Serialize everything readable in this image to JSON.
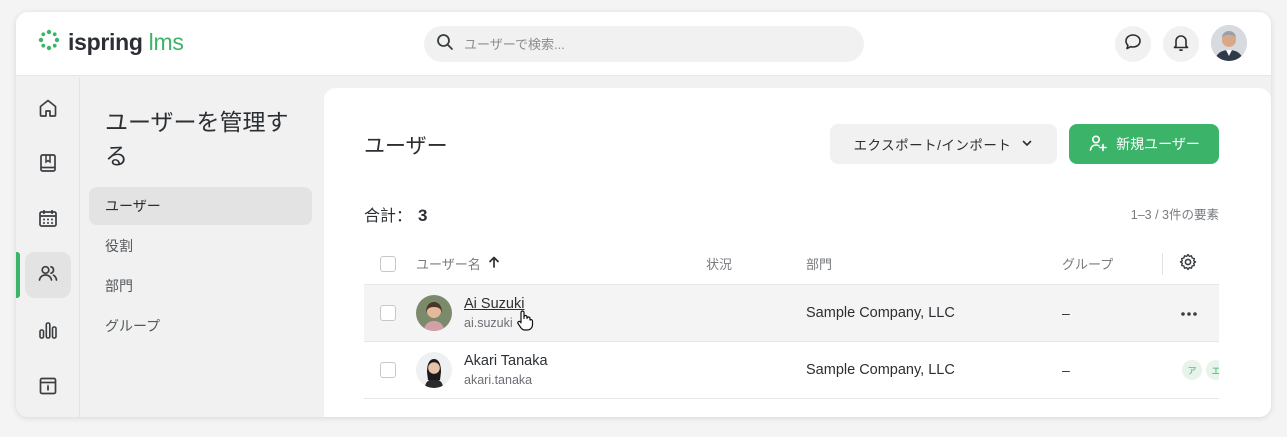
{
  "brand": {
    "name": "ispring",
    "suffix": "lms",
    "accent": "#3bb46a"
  },
  "search": {
    "placeholder": "ユーザーで検索..."
  },
  "header_icons": [
    "chat-icon",
    "bell-icon"
  ],
  "sidebar_icons": [
    "home-icon",
    "book-icon",
    "calendar-icon",
    "users-icon",
    "chart-icon",
    "archive-icon"
  ],
  "subnav": {
    "title": "ユーザーを管理する",
    "items": [
      {
        "label": "ユーザー",
        "active": true
      },
      {
        "label": "役割"
      },
      {
        "label": "部門"
      },
      {
        "label": "グループ"
      }
    ]
  },
  "main": {
    "title": "ユーザー",
    "export_label": "エクスポート/インポート",
    "new_user_label": "新規ユーザー",
    "total_label": "合計：",
    "total_count": "3",
    "pager_info": "1–3 / 3件の要素",
    "columns": {
      "username": "ユーザー名",
      "status": "状況",
      "department": "部門",
      "group": "グループ"
    },
    "rows": [
      {
        "name": "Ai Suzuki",
        "login": "ai.suzuki",
        "status": "",
        "department": "Sample Company, LLC",
        "group": "–"
      },
      {
        "name": "Akari Tanaka",
        "login": "akari.tanaka",
        "status": "",
        "department": "Sample Company, LLC",
        "group": "–",
        "tags": [
          "ア",
          "エ"
        ]
      }
    ]
  }
}
